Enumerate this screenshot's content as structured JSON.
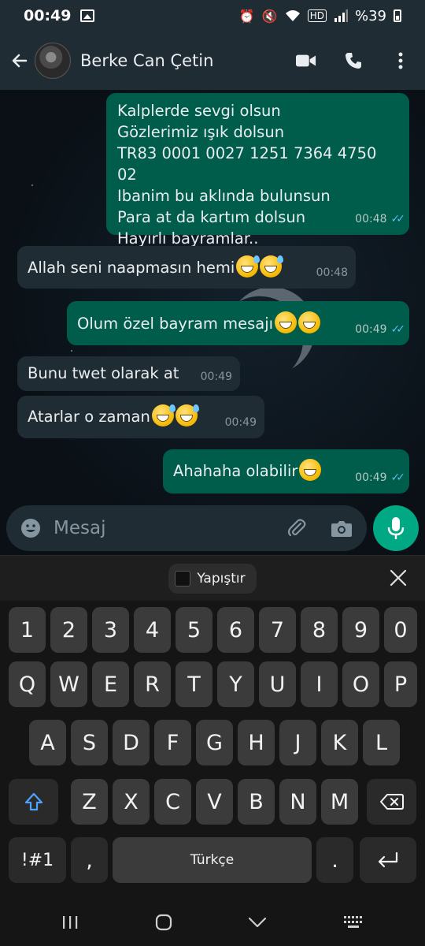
{
  "status_bar": {
    "time": "00:49",
    "battery": "%39"
  },
  "header": {
    "contact_name": "Berke Can Çetin"
  },
  "messages": [
    {
      "direction": "out",
      "lines": [
        "Kalplerde sevgi olsun",
        "Gözlerimiz ışık dolsun",
        "TR83 0001 0027 1251 7364 4750 02",
        "Ibanim bu aklında bulunsun",
        "Para at da kartım dolsun",
        "Hayırlı bayramlar.."
      ],
      "time": "00:48",
      "read": true
    },
    {
      "direction": "in",
      "text": "Allah seni naapmasın hemi",
      "emojis": [
        "sweat-smile",
        "sweat-smile"
      ],
      "time": "00:48"
    },
    {
      "direction": "out",
      "text": "Olum özel bayram mesajı",
      "emojis": [
        "grin",
        "grin"
      ],
      "time": "00:49",
      "read": true
    },
    {
      "direction": "in",
      "text": "Bunu twet olarak at",
      "emojis": [],
      "time": "00:49"
    },
    {
      "direction": "in",
      "text": "Atarlar o zaman",
      "emojis": [
        "sweat-smile",
        "sweat-smile"
      ],
      "time": "00:49"
    },
    {
      "direction": "out",
      "text": "Ahahaha olabilir",
      "emojis": [
        "grin"
      ],
      "time": "00:49",
      "read": true
    }
  ],
  "composer": {
    "placeholder": "Mesaj"
  },
  "keyboard": {
    "paste_label": "Yapıştır",
    "row_numbers": [
      "1",
      "2",
      "3",
      "4",
      "5",
      "6",
      "7",
      "8",
      "9",
      "0"
    ],
    "row1": [
      "Q",
      "W",
      "E",
      "R",
      "T",
      "Y",
      "U",
      "I",
      "O",
      "P"
    ],
    "row2": [
      "A",
      "S",
      "D",
      "F",
      "G",
      "H",
      "J",
      "K",
      "L"
    ],
    "row3": [
      "Z",
      "X",
      "C",
      "V",
      "B",
      "N",
      "M"
    ],
    "symbols_label": "!#1",
    "comma": ",",
    "space_label": "Türkçe",
    "period": "."
  },
  "colors": {
    "outgoing_bubble": "#005c4b",
    "incoming_bubble": "#202c33",
    "accent": "#00a884",
    "read_ticks": "#53bdeb"
  }
}
